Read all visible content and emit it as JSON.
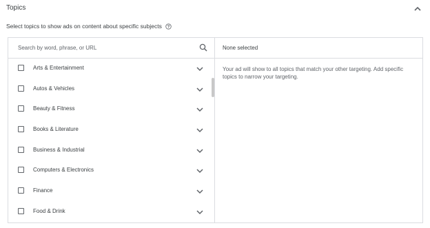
{
  "section": {
    "title": "Topics",
    "subtitle": "Select topics to show ads on content about specific subjects"
  },
  "icons": {
    "collapse": "chevron-up-icon",
    "help": "help-circle-icon",
    "search": "search-icon",
    "expand": "chevron-down-icon"
  },
  "search": {
    "placeholder": "Search by word, phrase, or URL",
    "value": ""
  },
  "topics": [
    {
      "label": "Arts & Entertainment",
      "checked": false
    },
    {
      "label": "Autos & Vehicles",
      "checked": false
    },
    {
      "label": "Beauty & Fitness",
      "checked": false
    },
    {
      "label": "Books & Literature",
      "checked": false
    },
    {
      "label": "Business & Industrial",
      "checked": false
    },
    {
      "label": "Computers & Electronics",
      "checked": false
    },
    {
      "label": "Finance",
      "checked": false
    },
    {
      "label": "Food & Drink",
      "checked": false
    }
  ],
  "selection": {
    "header": "None selected",
    "info": "Your ad will show to all topics that match your other targeting. Add specific topics to narrow your targeting."
  }
}
